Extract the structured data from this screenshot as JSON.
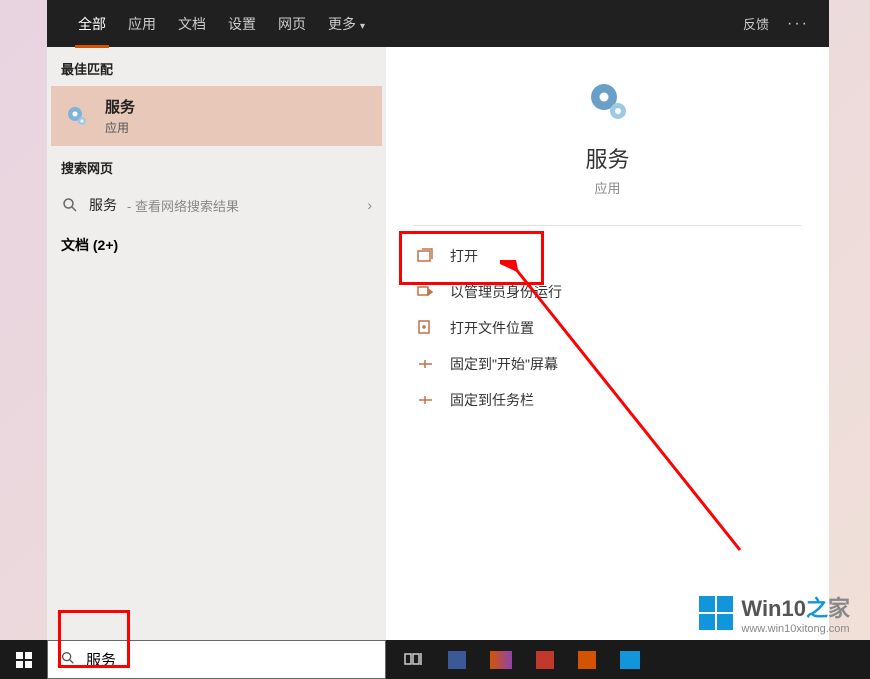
{
  "tabs": {
    "all": "全部",
    "apps": "应用",
    "docs": "文档",
    "settings": "设置",
    "web": "网页",
    "more": "更多"
  },
  "tabs_right": {
    "feedback": "反馈"
  },
  "left": {
    "best_match_header": "最佳匹配",
    "best_match": {
      "title": "服务",
      "subtitle": "应用"
    },
    "search_web_header": "搜索网页",
    "web_item_term": "服务",
    "web_item_hint": " - 查看网络搜索结果",
    "documents_header": "文档 (2+)"
  },
  "right": {
    "title": "服务",
    "subtitle": "应用",
    "actions": {
      "open": "打开",
      "run_admin": "以管理员身份运行",
      "open_location": "打开文件位置",
      "pin_start": "固定到\"开始\"屏幕",
      "pin_taskbar": "固定到任务栏"
    }
  },
  "search_box": {
    "value": "服务"
  },
  "watermark": {
    "zhi": "之",
    "jia": "家",
    "brand": "Win10",
    "url": "www.win10xitong.com"
  }
}
